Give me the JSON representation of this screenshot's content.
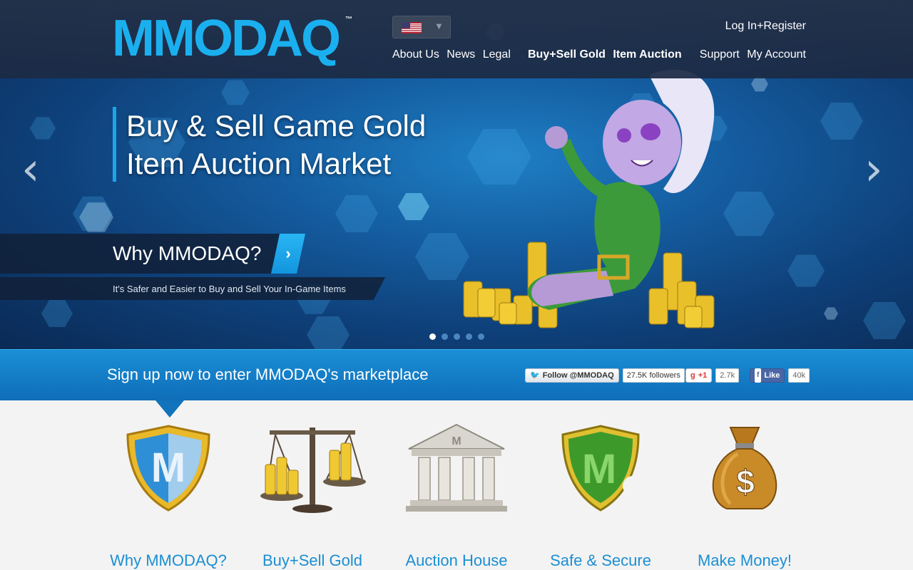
{
  "header": {
    "logo": "MMODAQ",
    "logo_tm": "™",
    "language_flag": "us-flag-icon",
    "login_register": "Log In+Register",
    "nav_left": [
      "About Us",
      "News",
      "Legal"
    ],
    "nav_mid": [
      "Buy+Sell Gold",
      "Item Auction"
    ],
    "nav_right": [
      "Support",
      "My Account"
    ]
  },
  "slider": {
    "title_line1": "Buy & Sell Game Gold",
    "title_line2": "Item Auction Market",
    "why_title": "Why MMODAQ?",
    "why_subtitle": "It's Safer and Easier to Buy and Sell Your In-Game Items",
    "dots_count": 5,
    "active_dot": 1
  },
  "cta": {
    "text": "Sign up now to enter MMODAQ's marketplace",
    "twitter_label": "Follow @MMODAQ",
    "twitter_count": "27.5K followers",
    "gplus_label": "+1",
    "gplus_count": "2.7k",
    "facebook_label": "Like",
    "facebook_count": "40k"
  },
  "features": [
    {
      "label": "Why MMODAQ?",
      "icon": "shield-m-icon"
    },
    {
      "label": "Buy+Sell Gold",
      "icon": "scale-gold-icon"
    },
    {
      "label": "Auction House",
      "icon": "auction-house-icon"
    },
    {
      "label": "Safe & Secure",
      "icon": "green-shield-icon"
    },
    {
      "label": "Make Money!",
      "icon": "money-bag-icon"
    }
  ],
  "colors": {
    "accent": "#1ab0ef",
    "cta_bar": "#1580cc",
    "feature_label": "#1b8fd2"
  }
}
